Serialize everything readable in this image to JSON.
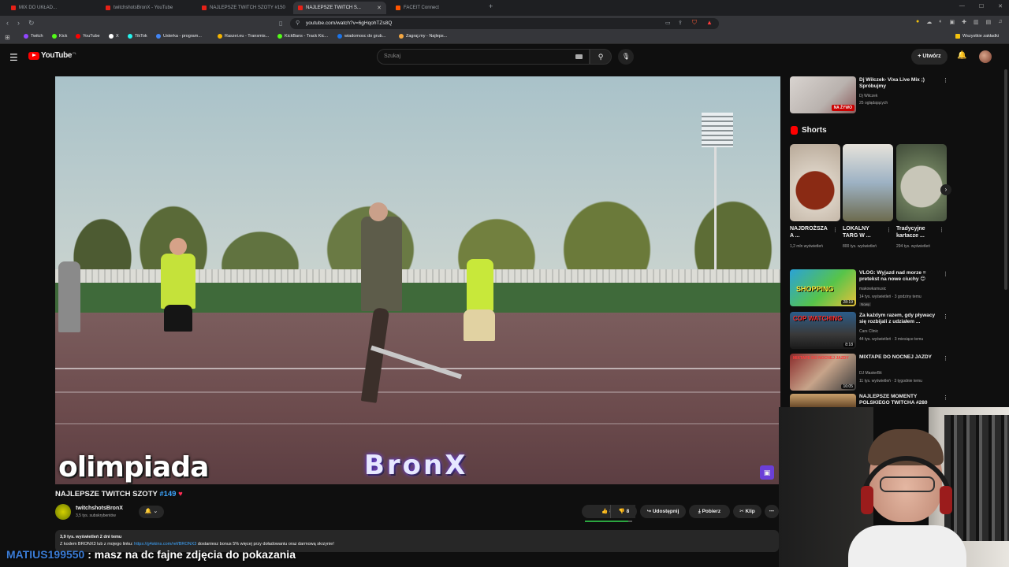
{
  "browser": {
    "tabs": [
      {
        "label": "MIX DO UKŁAD..."
      },
      {
        "label": "twitchshotsBronX - YouTube"
      },
      {
        "label": "NAJLEPSZE TWITCH SZOTY #150"
      },
      {
        "label": "NAJLEPSZE TWITCH S..."
      },
      {
        "label": "FACEIT Connect"
      }
    ],
    "url": "youtube.com/watch?v=6gHqohTZs8Q",
    "bookmarks": [
      {
        "label": "Twitch",
        "color": "#9146ff"
      },
      {
        "label": "Kick",
        "color": "#53fc18"
      },
      {
        "label": "YouTube",
        "color": "#ff0000"
      },
      {
        "label": "X",
        "color": "#ffffff"
      },
      {
        "label": "TikTok",
        "color": "#25f4ee"
      },
      {
        "label": "Usterka - program...",
        "color": "#4285f4"
      },
      {
        "label": "Raszei.eu - Transmis...",
        "color": "#f4b400"
      },
      {
        "label": "KickBans - Track Kic...",
        "color": "#53fc18"
      },
      {
        "label": "wiadomosc do grub...",
        "color": "#1a73e8"
      },
      {
        "label": "Zagraj.my - Najleps...",
        "color": "#f4a742"
      }
    ],
    "bookmarks_folder": "Wszystkie zakładki"
  },
  "youtube": {
    "logo_text": "YouTube",
    "logo_region": "PL",
    "search_placeholder": "Szukaj",
    "create_label": "Utwórz"
  },
  "video": {
    "overlay_text_left": "olimpiada",
    "overlay_brand": "BronX",
    "title_prefix": "NAJLEPSZE TWITCH SZOTY ",
    "title_number": "#149",
    "title_heart": "♥",
    "channel_name": "twitchshotsBronX",
    "channel_subs": "3,5 tys. subskrybentów",
    "likes": "86",
    "dislikes": "8",
    "like_ratio": 0.91,
    "share_label": "Udostępnij",
    "download_label": "Pobierz",
    "clip_label": "Klip",
    "desc_meta": "3,9 tys. wyświetleń  2 dni temu",
    "desc_prefix": "Z kodem BRONX3 lub z mojego linku: ",
    "desc_link": "https://g4skins.com/ref/BRONX3",
    "desc_suffix": " dostaniesz bonus 5% więcej przy doładowaniu oraz darmową skrzynie!"
  },
  "chat": {
    "user": "MATIUS199550",
    "message": " : masz na dc fajne zdjęcia do pokazania"
  },
  "sidebar": {
    "top_rec": {
      "title": "Dj Wilczek- Vixa Live Mix ;) Spróbujmy",
      "channel": "Dj Wilczek",
      "viewers": "25 oglądających",
      "live_label": "NA ŻYWO"
    },
    "shorts_label": "Shorts",
    "shorts": [
      {
        "title": "NAJDROŻSZA A ...",
        "views": "1,2 mln wyświetleń"
      },
      {
        "title": "LOKALNY TARG W ...",
        "views": "800 tys. wyświetleń"
      },
      {
        "title": "Tradycyjne kartacze ...",
        "views": "294 tys. wyświetleń"
      }
    ],
    "recs": [
      {
        "title": "VLOG: Wyjazd nad morze = pretekst na nowe ciuchy 😊",
        "channel": "makowkamusic",
        "meta": "14 tys. wyświetleń · 3 godziny temu",
        "badge": "Nowy",
        "duration": "28:19",
        "thumb_text": "SHOPPING"
      },
      {
        "title": "Za każdym razem, gdy pływacy się rozbijali z udziałem ...",
        "channel": "Cars Clinic",
        "meta": "44 tys. wyświetleń · 3 miesiące temu",
        "badge": "",
        "duration": "8:18",
        "thumb_text": "COP WATCHING"
      },
      {
        "title": "MIXTAPE DO NOCNEJ JAZDY",
        "channel": "DJ MasterBit",
        "meta": "11 tys. wyświetleń · 3 tygodnie temu",
        "badge": "",
        "duration": "16:05",
        "thumb_text": "MIXTAPE DO NOCNEJ JAZDY"
      },
      {
        "title": "NAJLEPSZE MOMENTY POLSKIEGO TWITCHA #280",
        "channel": "",
        "meta": "",
        "badge": "",
        "duration": "",
        "thumb_text": ""
      }
    ]
  }
}
